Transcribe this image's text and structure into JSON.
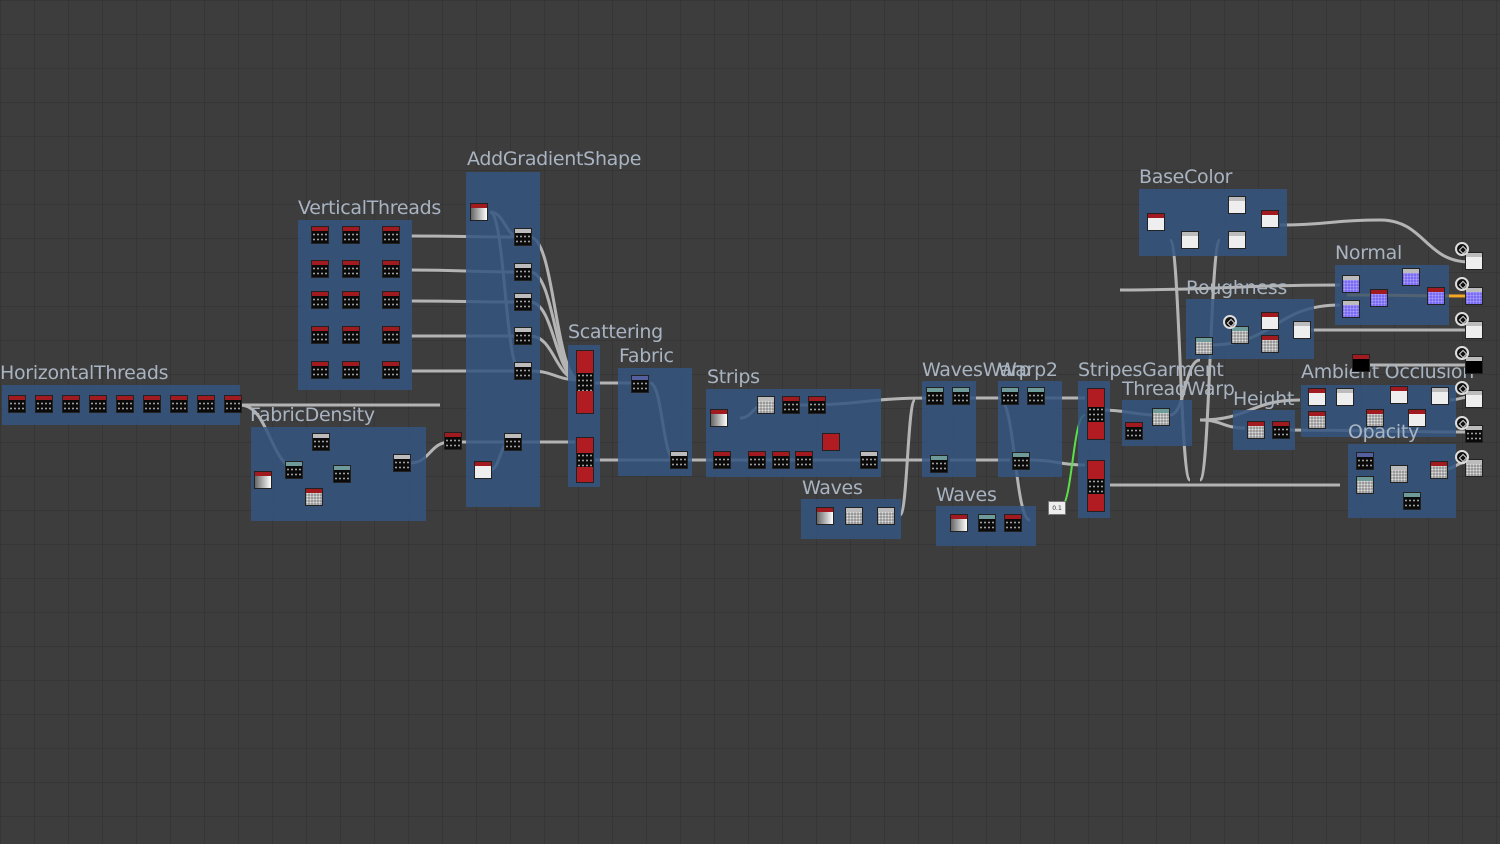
{
  "graph": {
    "frames": [
      {
        "id": "horizontal-threads",
        "title": "HorizontalThreads"
      },
      {
        "id": "vertical-threads",
        "title": "VerticalThreads"
      },
      {
        "id": "add-gradient-shape",
        "title": "AddGradientShape"
      },
      {
        "id": "fabric-density",
        "title": "FabricDensity"
      },
      {
        "id": "scattering",
        "title": "Scattering"
      },
      {
        "id": "fabric",
        "title": "Fabric"
      },
      {
        "id": "strips",
        "title": "Strips"
      },
      {
        "id": "waves-1",
        "title": "Waves"
      },
      {
        "id": "waves-warp",
        "title": "WavesWarp"
      },
      {
        "id": "warp2",
        "title": "Warp2"
      },
      {
        "id": "waves-2",
        "title": "Waves"
      },
      {
        "id": "stripes-garment",
        "title": "StripesGarment"
      },
      {
        "id": "thread-warp",
        "title": "ThreadWarp"
      },
      {
        "id": "base-color",
        "title": "BaseColor"
      },
      {
        "id": "normal",
        "title": "Normal"
      },
      {
        "id": "roughness",
        "title": "Roughness"
      },
      {
        "id": "height",
        "title": "Height"
      },
      {
        "id": "ambient-occlusion",
        "title": "Ambient Occlusion"
      },
      {
        "id": "opacity",
        "title": "Opacity"
      }
    ],
    "value_node": "0.1",
    "colors": {
      "frame": "#345680",
      "wire": "#b4b4b4",
      "normal_wire": "#f5a623",
      "green_wire": "#5be04a",
      "node_header_red": "#a01a20"
    }
  }
}
